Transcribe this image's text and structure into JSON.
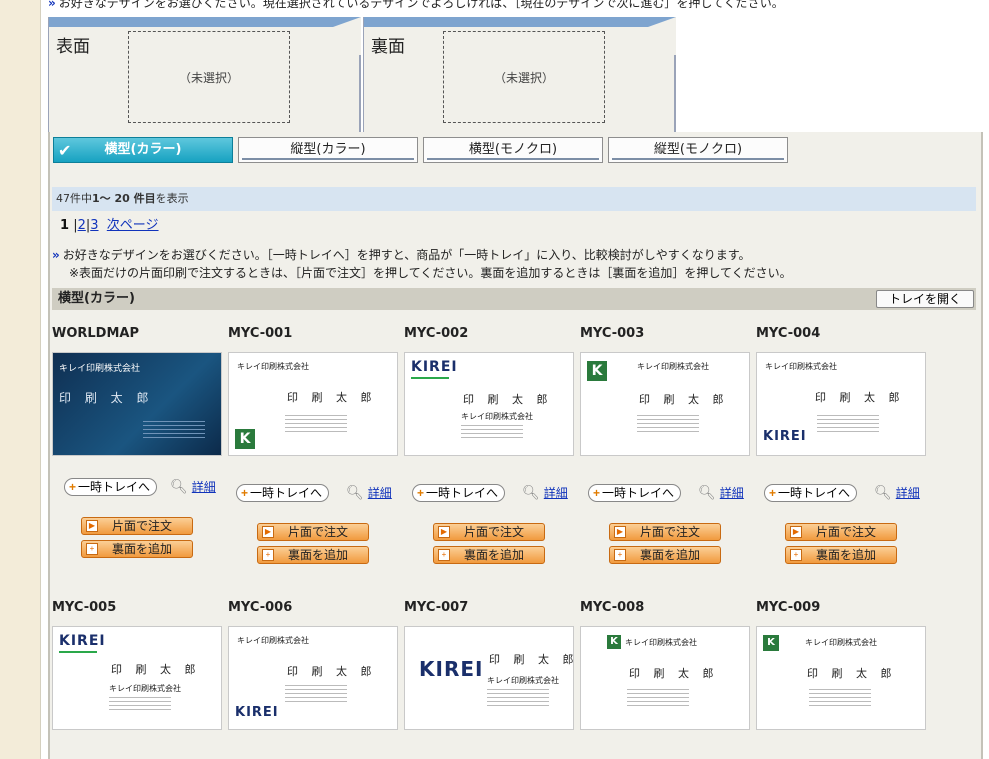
{
  "top_note": "お好きなデザインをお選びください。現在選択されているデザインでよろしければ、［現在のデザインで次に進む］を押してください。",
  "front": {
    "title": "表面",
    "placeholder": "（未選択）"
  },
  "back": {
    "title": "裏面",
    "placeholder": "（未選択）"
  },
  "tabs": [
    {
      "label": "横型(カラー)",
      "active": true
    },
    {
      "label": "縦型(カラー)",
      "active": false
    },
    {
      "label": "横型(モノクロ)",
      "active": false
    },
    {
      "label": "縦型(モノクロ)",
      "active": false
    }
  ],
  "count": {
    "total": "47件中",
    "range": "1〜 20 件目",
    "suffix": "を表示"
  },
  "pager": {
    "current": "1",
    "p2": "2",
    "p3": "3",
    "next": "次ページ",
    "sep": "|"
  },
  "info": {
    "line1": "お好きなデザインをお選びください。［一時トレイへ］を押すと、商品が「一時トレイ」に入り、比較検討がしやすくなります。",
    "line2": "※表面だけの片面印刷で注文するときは、［片面で注文］を押してください。裏面を追加するときは［裏面を追加］を押してください。"
  },
  "section": {
    "title": "横型(カラー)",
    "tray_open": "トレイを開く"
  },
  "buttons": {
    "tray": "一時トレイへ",
    "detail": "詳細",
    "single_order": "片面で注文",
    "add_back": "裏面を追加"
  },
  "card_text": {
    "company": "キレイ印刷株式会社",
    "person": "印 刷 太 郎",
    "kirei": "KIREI"
  },
  "products": [
    {
      "code": "WORLDMAP"
    },
    {
      "code": "MYC-001"
    },
    {
      "code": "MYC-002"
    },
    {
      "code": "MYC-003"
    },
    {
      "code": "MYC-004"
    },
    {
      "code": "MYC-005"
    },
    {
      "code": "MYC-006"
    },
    {
      "code": "MYC-007"
    },
    {
      "code": "MYC-008"
    },
    {
      "code": "MYC-009"
    }
  ],
  "colors": {
    "accent": "#17a2c1",
    "orange": "#f19a3e",
    "link": "#1133bb",
    "band": "#7ea4cf"
  }
}
